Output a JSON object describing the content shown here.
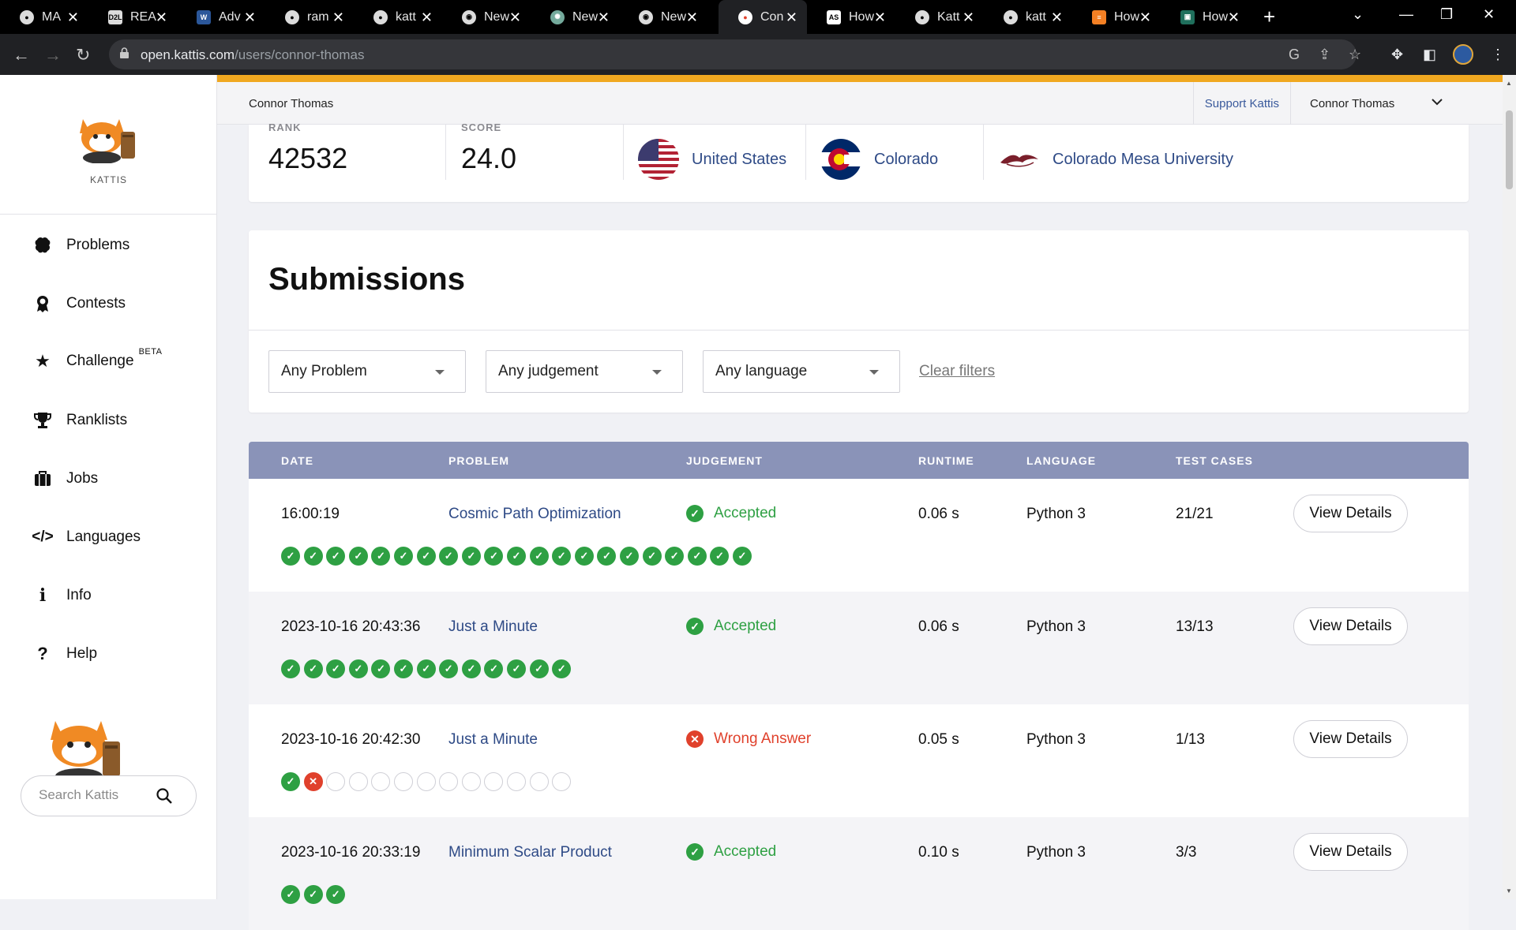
{
  "browser": {
    "tabs": [
      {
        "title": "MA",
        "icon": "github-icon"
      },
      {
        "title": "REA",
        "icon": "d2l-icon"
      },
      {
        "title": "Adv",
        "icon": "word-icon"
      },
      {
        "title": "ram",
        "icon": "github-icon"
      },
      {
        "title": "katt",
        "icon": "github-icon"
      },
      {
        "title": "New",
        "icon": "chrome-icon"
      },
      {
        "title": "New",
        "icon": "chatgpt-icon"
      },
      {
        "title": "New",
        "icon": "chrome-icon"
      },
      {
        "title": "Con",
        "icon": "kattis-icon",
        "active": true
      },
      {
        "title": "How",
        "icon": "as-icon"
      },
      {
        "title": "Katt",
        "icon": "github-icon"
      },
      {
        "title": "katt",
        "icon": "github-icon"
      },
      {
        "title": "How",
        "icon": "stackoverflow-icon"
      },
      {
        "title": "How",
        "icon": "page-icon"
      }
    ],
    "url_host": "open.kattis.com",
    "url_path": "/users/connor-thomas"
  },
  "sidebar": {
    "logo_label": "KATTIS",
    "items": [
      {
        "label": "Problems",
        "icon": "brain-icon"
      },
      {
        "label": "Contests",
        "icon": "medal-icon"
      },
      {
        "label": "Challenge",
        "icon": "star-icon",
        "badge": "BETA"
      },
      {
        "label": "Ranklists",
        "icon": "trophy-icon"
      },
      {
        "label": "Jobs",
        "icon": "briefcase-icon"
      },
      {
        "label": "Languages",
        "icon": "code-icon"
      },
      {
        "label": "Info",
        "icon": "info-icon"
      },
      {
        "label": "Help",
        "icon": "question-icon"
      }
    ],
    "search_placeholder": "Search Kattis"
  },
  "topbar": {
    "user_name": "Connor Thomas",
    "support_label": "Support Kattis",
    "account_label": "Connor Thomas"
  },
  "profile": {
    "rank_label": "RANK",
    "rank_value": "42532",
    "score_label": "SCORE",
    "score_value": "24.0",
    "country": "United States",
    "state": "Colorado",
    "university": "Colorado Mesa University"
  },
  "submissions": {
    "title": "Submissions",
    "filters": {
      "problem": "Any Problem",
      "judgement": "Any judgement",
      "language": "Any language",
      "clear": "Clear filters"
    },
    "columns": {
      "date": "DATE",
      "problem": "PROBLEM",
      "judgement": "JUDGEMENT",
      "runtime": "RUNTIME",
      "language": "LANGUAGE",
      "test_cases": "TEST CASES"
    },
    "view_details_label": "View Details",
    "rows": [
      {
        "date": "16:00:19",
        "problem": "Cosmic Path Optimization",
        "judgement": "Accepted",
        "status": "ok",
        "runtime": "0.06 s",
        "language": "Python 3",
        "test_cases": "21/21",
        "tests": "ppppppppppppppppppppp"
      },
      {
        "date": "2023-10-16 20:43:36",
        "problem": "Just a Minute",
        "judgement": "Accepted",
        "status": "ok",
        "runtime": "0.06 s",
        "language": "Python 3",
        "test_cases": "13/13",
        "tests": "ppppppppppppp"
      },
      {
        "date": "2023-10-16 20:42:30",
        "problem": "Just a Minute",
        "judgement": "Wrong Answer",
        "status": "bad",
        "runtime": "0.05 s",
        "language": "Python 3",
        "test_cases": "1/13",
        "tests": "pfnnnnnnnnnnn"
      },
      {
        "date": "2023-10-16 20:33:19",
        "problem": "Minimum Scalar Product",
        "judgement": "Accepted",
        "status": "ok",
        "runtime": "0.10 s",
        "language": "Python 3",
        "test_cases": "3/3",
        "tests": "ppp"
      }
    ]
  },
  "colors": {
    "accent": "#f0a820",
    "accepted": "#2ea043",
    "wrong": "#e0412c",
    "table_header": "#8a93b8",
    "link": "#2e4a86"
  }
}
